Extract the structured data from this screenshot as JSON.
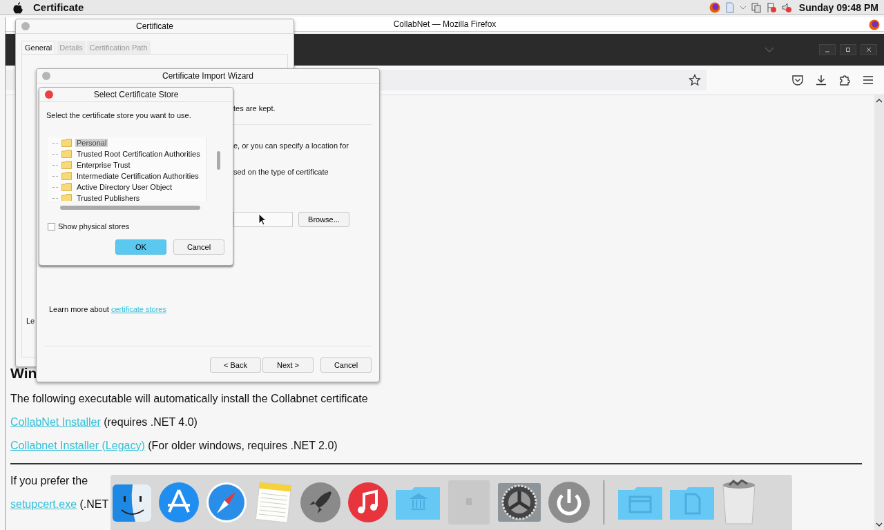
{
  "menubar": {
    "app_name": "Certificate",
    "clock": "Sunday 09:48 PM"
  },
  "browser": {
    "title": "CollabNet — Mozilla Firefox",
    "page": {
      "heading_fragment": "Win",
      "intro": "The following executable will automatically install the Collabnet certificate",
      "installers": [
        {
          "link": "CollabNet Installer",
          "note": "(requires .NET 4.0)"
        },
        {
          "link": "Collabnet Installer (Legacy)",
          "note": "(For older windows, requires .NET 2.0)"
        }
      ],
      "prefer_text": "If you prefer the",
      "last_installer": {
        "link": "setupcert.exe",
        "note": "(.NET"
      }
    }
  },
  "certificate_window": {
    "title": "Certificate",
    "tabs": [
      {
        "label": "General",
        "selected": true
      },
      {
        "label": "Details",
        "selected": false
      },
      {
        "label": "Certification Path",
        "selected": false
      }
    ],
    "text_fragment": "Le"
  },
  "import_wizard": {
    "title": "Certificate Import Wizard",
    "text_fragments": [
      "tes are kept.",
      "e, or you can specify a location for",
      "sed on the type of certificate"
    ],
    "browse_button": "Browse...",
    "learn_more": {
      "text": "Learn more about",
      "link": "certificate stores"
    },
    "buttons": [
      "< Back",
      "Next >",
      "Cancel"
    ]
  },
  "store_dialog": {
    "title": "Select Certificate Store",
    "prompt": "Select the certificate store you want to use.",
    "stores": [
      {
        "label": "Personal",
        "selected": true
      },
      {
        "label": "Trusted Root Certification Authorities",
        "selected": false
      },
      {
        "label": "Enterprise Trust",
        "selected": false
      },
      {
        "label": "Intermediate Certification Authorities",
        "selected": false
      },
      {
        "label": "Active Directory User Object",
        "selected": false
      },
      {
        "label": "Trusted Publishers",
        "selected": false
      }
    ],
    "show_physical_stores": {
      "label": "Show physical stores",
      "checked": false
    },
    "buttons": [
      {
        "label": "OK",
        "kind": "default"
      },
      {
        "label": "Cancel",
        "kind": "normal"
      }
    ]
  }
}
